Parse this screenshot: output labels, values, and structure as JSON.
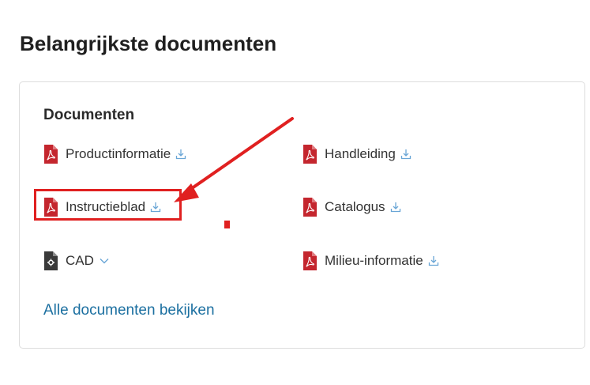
{
  "page": {
    "title": "Belangrijkste documenten"
  },
  "documents_section": {
    "title": "Documenten",
    "items": [
      {
        "label": "Productinformatie",
        "icon": "pdf-icon",
        "action_icon": "download-icon"
      },
      {
        "label": "Handleiding",
        "icon": "pdf-icon",
        "action_icon": "download-icon"
      },
      {
        "label": "Instructieblad",
        "icon": "pdf-icon",
        "action_icon": "download-icon"
      },
      {
        "label": "Catalogus",
        "icon": "pdf-icon",
        "action_icon": "download-icon"
      },
      {
        "label": "CAD",
        "icon": "cad-file-icon",
        "action_icon": "chevron-down-icon"
      },
      {
        "label": "Milieu-informatie",
        "icon": "pdf-icon",
        "action_icon": "download-icon"
      }
    ],
    "all_link": "Alle documenten bekijken"
  },
  "colors": {
    "pdf_red": "#c4262e",
    "link_blue": "#1b6fa0",
    "icon_blue": "#6aa6d6",
    "annotation_red": "#e02020"
  }
}
